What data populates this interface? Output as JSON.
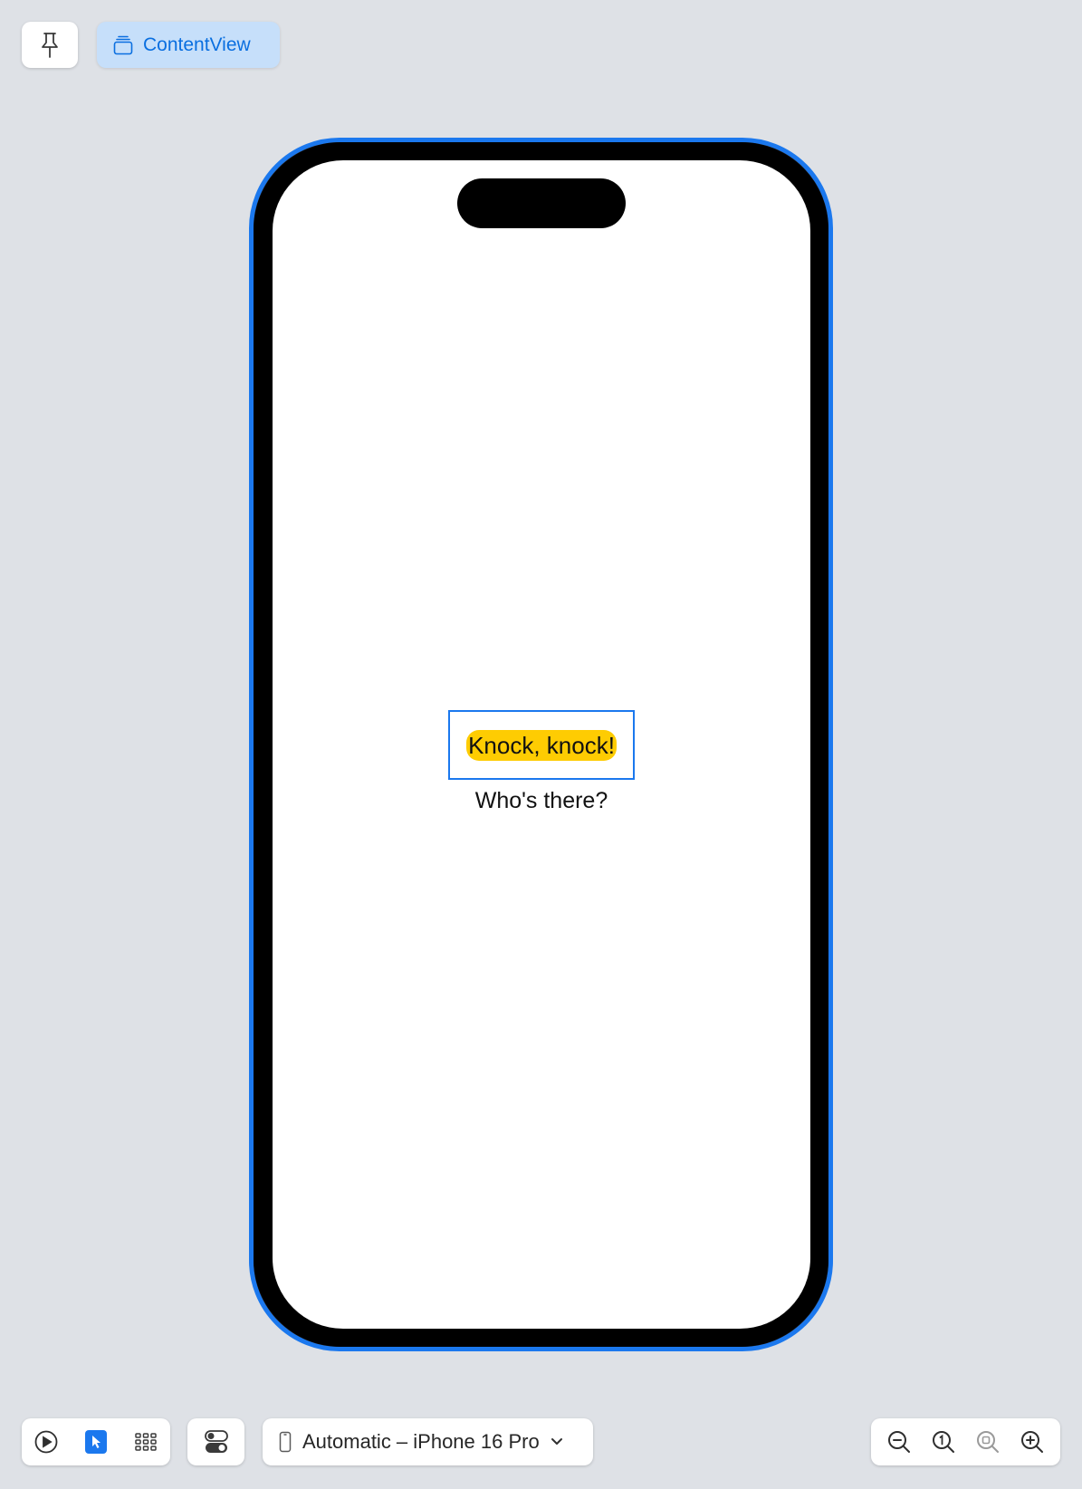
{
  "toolbar": {
    "view_label": "ContentView"
  },
  "preview": {
    "greeting": "Knock, knock!",
    "reply": "Who's there?",
    "highlight_color": "#fecc02",
    "selection_color": "#1b78ee"
  },
  "bottom_bar": {
    "device_label": "Automatic – iPhone 16 Pro",
    "mode_buttons": [
      "live-preview",
      "selectable",
      "variants"
    ],
    "zoom_buttons": [
      "zoom-out",
      "actual-size",
      "zoom-to-fit",
      "zoom-in"
    ]
  }
}
